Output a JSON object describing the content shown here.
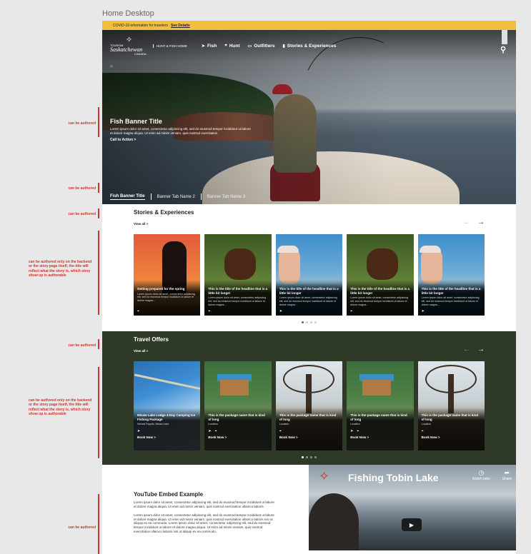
{
  "frame_title": "Home Desktop",
  "annotations": {
    "a1": "can be authored",
    "a2": "can be authored",
    "a3": "can be authored",
    "a4": "can be authored only on the backend or the story page itself, the title will reflect what the story is, which story show up is authorable",
    "a5": "can be authored",
    "a6": "can be authored only on the backend or the story page itself, the title will reflect what the story is, which story show up is authorable",
    "a7": "can be authored"
  },
  "alert": {
    "text": "COVID-19 information for travelers",
    "link": "See Details"
  },
  "logo": {
    "line1": "TOURISM",
    "line2": "Saskatchewan",
    "line3": "CANADA"
  },
  "nav": {
    "sub": "HUNT & FISH HOME",
    "items": [
      {
        "icon": "fish-icon",
        "glyph": "➤",
        "label": "Fish"
      },
      {
        "icon": "crosshair-icon",
        "glyph": "⌖",
        "label": "Hunt"
      },
      {
        "icon": "bed-icon",
        "glyph": "▭",
        "label": "Outfitters"
      },
      {
        "icon": "book-icon",
        "glyph": "▮",
        "label": "Stories & Experiences"
      }
    ]
  },
  "hero": {
    "title": "Fish Banner Title",
    "body": "Lorem ipsum dolor sit amet, consectetur adipiscing elit, sed do eiusmod tempor incididunt ut labore et dolore magna aliqua. Ut enim ad minim veniam, quis nostrud exercitation",
    "cta": "Call to Action >",
    "tabs": [
      "Fish Banner Title",
      "Banner Tab Name 2",
      "Banner Tab Name 3"
    ]
  },
  "stories": {
    "title": "Stories & Experiences",
    "view_all": "View all >",
    "cards": [
      {
        "title": "Getting prepared for the spring",
        "desc": "Lorem ipsum dolor sit amet, consectetur adipiscing elit, sed do eiusmod tempor incididunt ut labore et dolore magna...",
        "icon": "crosshair-icon"
      },
      {
        "title": "This is the title of the headline that is a little bit longer",
        "desc": "Lorem ipsum dolor sit amet, consectetur adipiscing elit, sed do eiusmod tempor incididunt ut labore et dolore magna...",
        "icon": "crosshair-icon"
      },
      {
        "title": "This is the title of the headline that is a little bit longer",
        "desc": "Lorem ipsum dolor sit amet, consectetur adipiscing elit, sed do eiusmod tempor incididunt ut labore et dolore magna...",
        "icon": "fish-icon"
      },
      {
        "title": "This is the title of the headline that is a little bit longer",
        "desc": "Lorem ipsum dolor sit amet, consectetur adipiscing elit, sed do eiusmod tempor incididunt ut labore et dolore magna...",
        "icon": "crosshair-icon"
      },
      {
        "title": "This is the title of the headline that is a little bit longer",
        "desc": "Lorem ipsum dolor sit amet, consectetur adipiscing elit, sed do eiusmod tempor incididunt ut labore et dolore magna...",
        "icon": "fish-icon"
      }
    ]
  },
  "offers": {
    "title": "Travel Offers",
    "view_all": "View all >",
    "cards": [
      {
        "title": "Misaw Lake Lodge 4-Day Camping Ice Fishing Package",
        "loc": "Nemeil Rapids, Misaw Lake",
        "book": "Book Now >"
      },
      {
        "title": "This is the package name that is kind of long",
        "loc": "Location",
        "book": "Book Now >"
      },
      {
        "title": "This is the package name that is kind of long",
        "loc": "Location",
        "book": "Book Now >"
      },
      {
        "title": "This is the package name that is kind of long",
        "loc": "Location",
        "book": "Book Now >"
      },
      {
        "title": "This is the package name that is kind of long",
        "loc": "Location",
        "book": "Book Now >"
      }
    ]
  },
  "youtube": {
    "title": "YouTube Embed Example",
    "p1": "Lorem ipsum dolor sit amet, consectetur adipiscing elit, sed do eiusmod tempor incididunt ut labore et dolore magna aliqua. Ut enim ad minim veniam, quis nostrud exercitation ullamco laboris.",
    "p2": "Lorem ipsum dolor sit amet, consectetur adipiscing elit, sed do eiusmod tempor incididunt ut labore et dolore magna aliqua. Ut enim ad minim veniam, quis nostrud exercitation ullamco laboris nisi ut aliquip ex ea commodo. Lorem ipsum dolor sit amet, consectetur adipiscing elit, sed do eiusmod tempor incididunt ut labore et dolore magna aliqua. Ut enim ad minim veniam, quis nostrud exercitation ullamco laboris nisi ut aliquip ex ea commodo.",
    "video_title": "Fishing Tobin Lake",
    "watch_later": "Watch later",
    "share": "Share"
  },
  "colors": {
    "alert": "#f3bd3f",
    "annotation": "#d0352b",
    "offers_bg": "#2e3a27"
  }
}
